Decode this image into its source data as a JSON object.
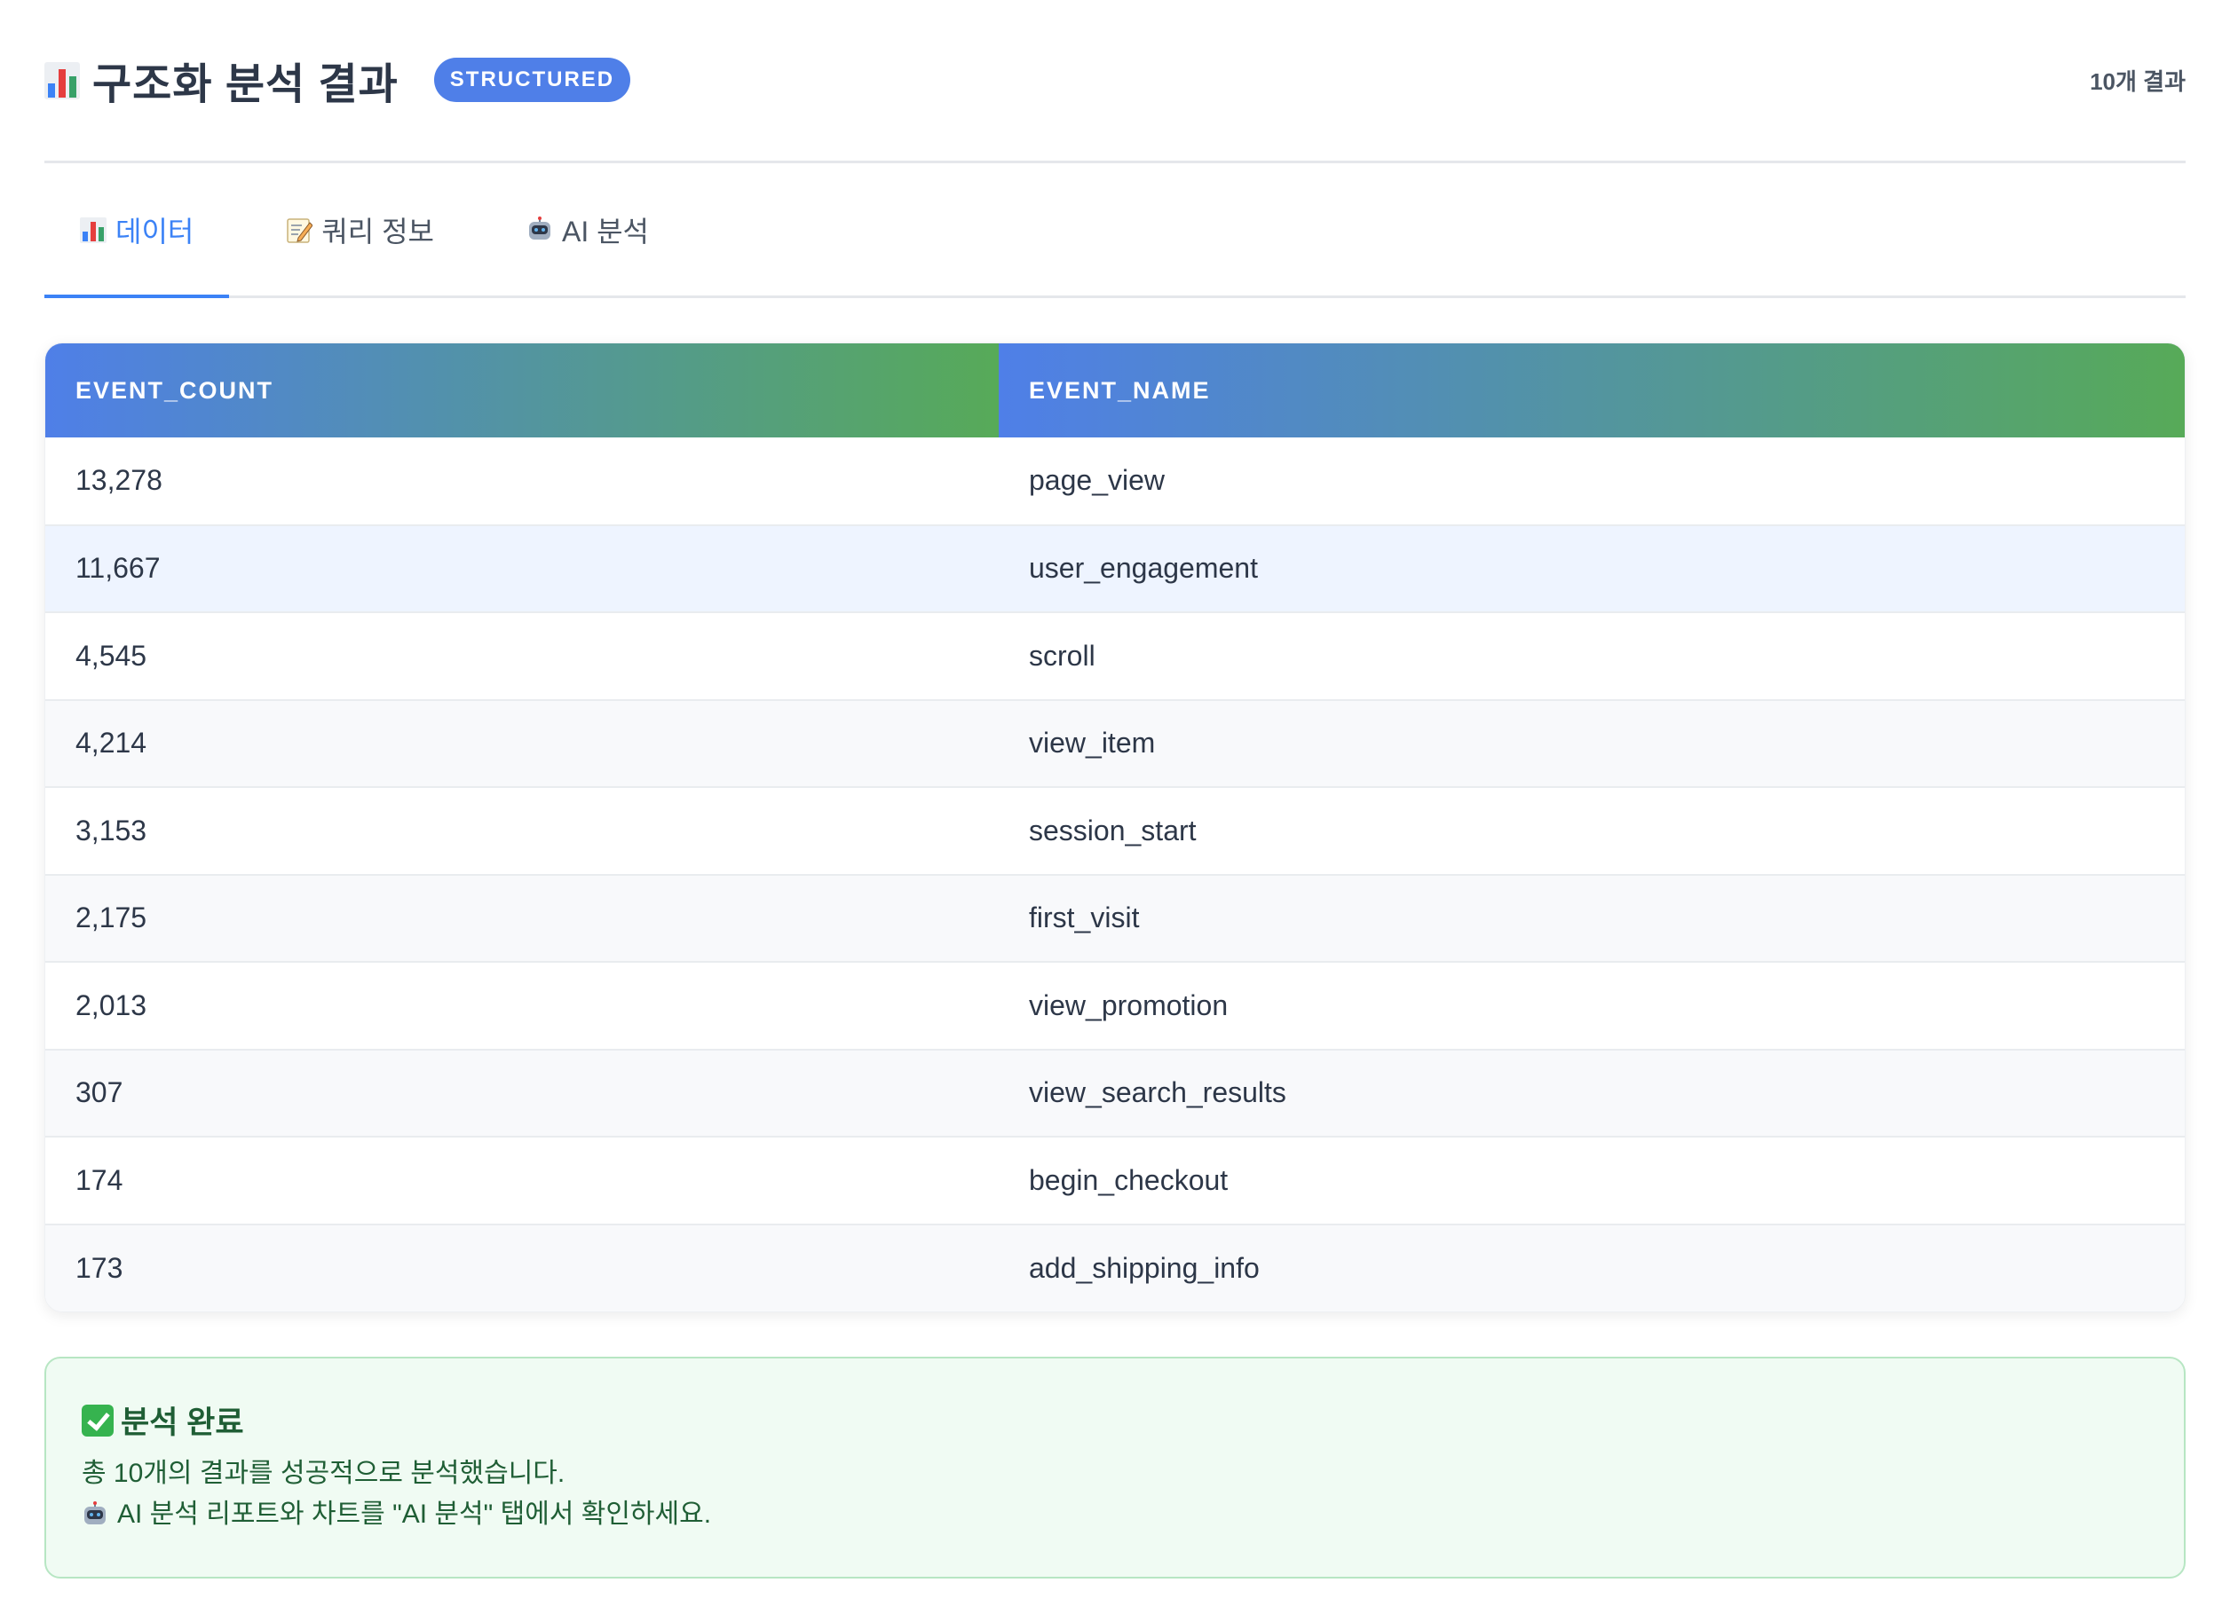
{
  "header": {
    "title": "구조화 분석 결과",
    "badge": "STRUCTURED",
    "result_count": "10개 결과",
    "icon": "bar-chart-icon"
  },
  "tabs": [
    {
      "label": "데이터",
      "icon": "bar-chart-icon",
      "active": true
    },
    {
      "label": "쿼리 정보",
      "icon": "memo-icon",
      "active": false
    },
    {
      "label": "AI 분석",
      "icon": "robot-icon",
      "active": false
    }
  ],
  "table": {
    "columns": [
      "EVENT_COUNT",
      "EVENT_NAME"
    ],
    "rows": [
      [
        "13,278",
        "page_view"
      ],
      [
        "11,667",
        "user_engagement"
      ],
      [
        "4,545",
        "scroll"
      ],
      [
        "4,214",
        "view_item"
      ],
      [
        "3,153",
        "session_start"
      ],
      [
        "2,175",
        "first_visit"
      ],
      [
        "2,013",
        "view_promotion"
      ],
      [
        "307",
        "view_search_results"
      ],
      [
        "174",
        "begin_checkout"
      ],
      [
        "173",
        "add_shipping_info"
      ]
    ]
  },
  "success": {
    "title": "분석 완료",
    "line1": "총 10개의 결과를 성공적으로 분석했습니다.",
    "line2": "AI 분석 리포트와 차트를 \"AI 분석\" 탭에서 확인하세요.",
    "icon": "check-icon"
  },
  "colors": {
    "accent": "#3b82f6",
    "badge": "#4f7fe8",
    "header_gradient_start": "#4f7fe8",
    "header_gradient_end": "#57aa58",
    "success_bg": "#f0fbf3",
    "success_border": "#b7e6c3",
    "success_text": "#1f5e35"
  }
}
